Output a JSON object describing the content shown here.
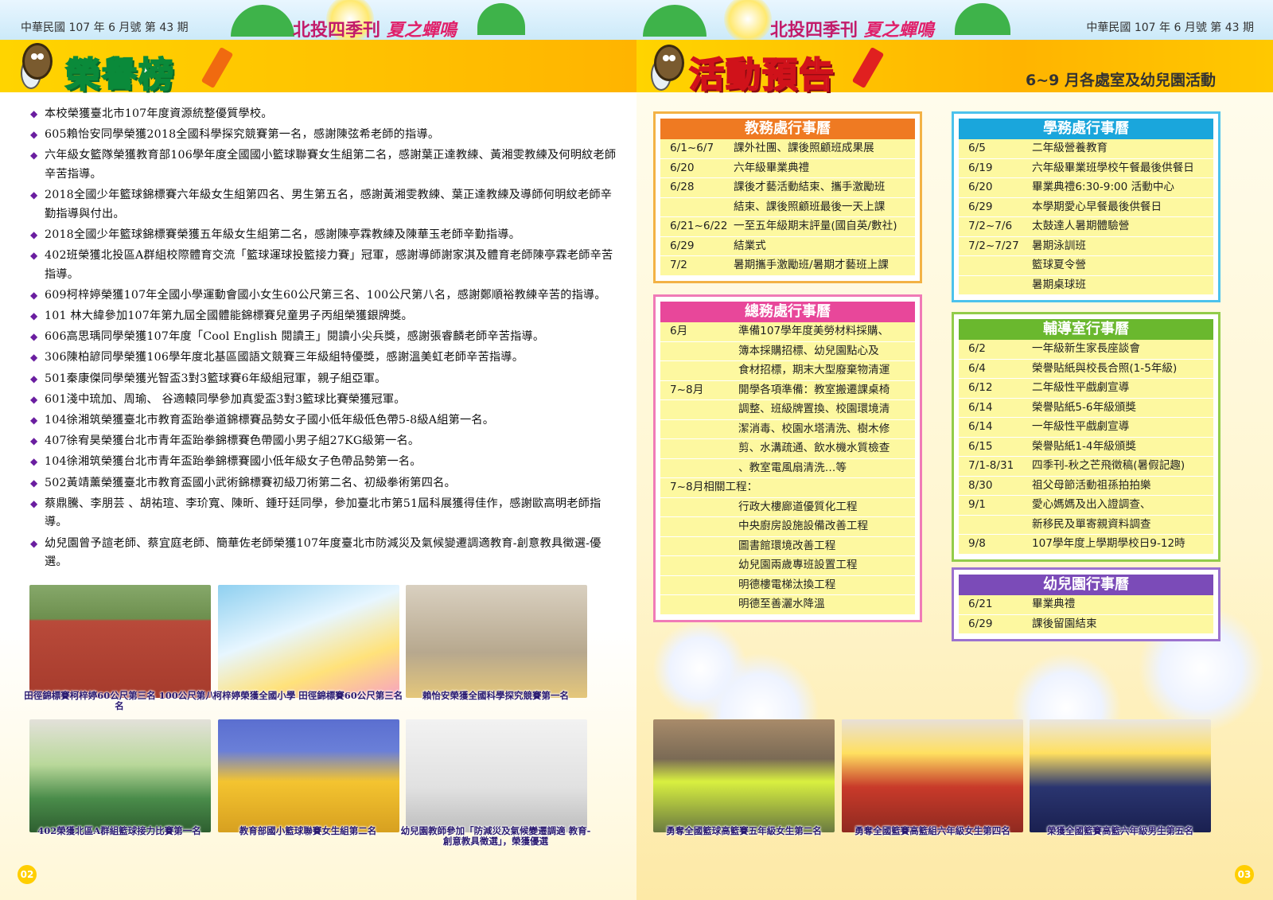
{
  "header": {
    "issue_left": "中華民國 107 年 6 月號 第 43 期",
    "issue_right": "中華民國 107 年 6 月號 第 43 期",
    "magazine": "北投四季刊",
    "magazine_sub": "夏之蟬鳴"
  },
  "left": {
    "section_title": "榮譽榜",
    "honors": [
      "本校榮獲臺北市107年度資源統整優質學校。",
      "605賴怡安同學榮獲2018全國科學探究競賽第一名，感謝陳弦希老師的指導。",
      "六年級女籃隊榮獲教育部106學年度全國國小籃球聯賽女生組第二名，感謝葉正達教練、黃湘雯教練及何明紋老師辛苦指導。",
      "2018全國少年籃球錦標賽六年級女生組第四名、男生第五名，感謝黃湘雯教練、葉正達教練及導師何明紋老師辛勤指導與付出。",
      "2018全國少年籃球錦標賽榮獲五年級女生組第二名，感謝陳亭霖教練及陳華玉老師辛勤指導。",
      "402班榮獲北投區A群組校際體育交流「籃球運球投籃接力賽」冠軍，感謝導師謝家淇及體育老師陳亭霖老師辛苦指導。",
      "609柯梓婷榮獲107年全國小學運動會國小女生60公尺第三名、100公尺第八名，感謝鄭順裕教練辛苦的指導。",
      "101 林大緯參加107年第九屆全國體能錦標賽兒童男子丙組榮獲銀牌獎。",
      "606高思瑀同學榮獲107年度「Cool English 閱讀王」閱讀小尖兵獎，感謝張睿麟老師辛苦指導。",
      "306陳柏諺同學榮獲106學年度北基區國語文競賽三年級組特優獎，感謝溫美虹老師辛苦指導。",
      "501秦康傑同學榮獲光智盃3對3籃球賽6年級組冠軍，親子組亞軍。",
      "601淺中琉加、周瑜、 谷適轅同學參加真愛盃3對3籃球比賽榮獲冠軍。",
      "104徐湘筑榮獲臺北市教育盃跆拳道錦標賽品勢女子國小低年級低色帶5-8級A組第一名。",
      "407徐宥昊榮獲台北市青年盃跆拳錦標賽色帶國小男子組27KG級第一名。",
      "104徐湘筑榮獲台北市青年盃跆拳錦標賽國小低年級女子色帶品勢第一名。",
      "502黃靖薰榮獲臺北市教育盃國小武術錦標賽初級刀術第二名、初級拳術第四名。",
      "蔡鼎騰、李朋芸 、胡祐瑄、李玠寬、陳昕、鍾玗廷同學，參加臺北市第51屆科展獲得佳作，感謝歐高明老師指導。",
      "幼兒園曾予諠老師、蔡宜庭老師、簡華佐老師榮獲107年度臺北市防減災及氣候變遷調適教育-創意教具徵選-優選。"
    ],
    "photos_row1": [
      {
        "caption": "田徑錦標賽柯梓婷60公尺第三名 100公尺第八名"
      },
      {
        "caption": "柯梓婷榮獲全國小學 田徑錦標賽60公尺第三名"
      },
      {
        "caption": "賴怡安榮獲全國科學探究競賽第一名"
      }
    ],
    "photos_row2": [
      {
        "caption": "402榮獲北區A群組籃球接力比賽第一名"
      },
      {
        "caption": "教育部國小籃球聯賽女生組第二名"
      },
      {
        "caption": "幼兒園教師參加「防減災及氣候變遷調適 教育-創意教具徵選」，榮獲優選"
      }
    ],
    "page_number": "02"
  },
  "right": {
    "section_title": "活動預告",
    "subtitle": "6~9 月各處室及幼兒園活動",
    "academic": {
      "title": "教務處行事曆",
      "color": "#ef7a22",
      "rows": [
        {
          "date": "6/1~6/7",
          "text": "課外社團、課後照顧班成果展"
        },
        {
          "date": "6/20",
          "text": "六年級畢業典禮"
        },
        {
          "date": "6/28",
          "text": "課後才藝活動結束、攜手激勵班"
        },
        {
          "date": "",
          "text": "結束、課後照顧班最後一天上課"
        },
        {
          "date": "6/21~6/22",
          "text": "一至五年級期末評量(國自英/數社)"
        },
        {
          "date": "6/29",
          "text": "結業式"
        },
        {
          "date": "7/2",
          "text": "暑期攜手激勵班/暑期才藝班上課"
        }
      ]
    },
    "general": {
      "title": "總務處行事曆",
      "color": "#e8479a",
      "rows": [
        {
          "date": "6月",
          "text": "準備107學年度美勞材料採購、"
        },
        {
          "date": "",
          "text": "簿本採購招標、幼兒園點心及"
        },
        {
          "date": "",
          "text": "食材招標，期末大型廢棄物清運"
        },
        {
          "date": "7~8月",
          "text": "開學各項準備：教室搬遷課桌椅"
        },
        {
          "date": "",
          "text": "調整、班級牌置換、校園環境清"
        },
        {
          "date": "",
          "text": "潔消毒、校園水塔清洗、樹木修"
        },
        {
          "date": "",
          "text": "剪、水溝疏通、飲水機水質檢查"
        },
        {
          "date": "",
          "text": "、教室電風扇清洗…等"
        },
        {
          "date": "7~8月相關工程：",
          "text": ""
        },
        {
          "date": "",
          "text": "行政大樓廊道優質化工程"
        },
        {
          "date": "",
          "text": "中央廚房設施設備改善工程"
        },
        {
          "date": "",
          "text": "圖書館環境改善工程"
        },
        {
          "date": "",
          "text": "幼兒園兩歲專班設置工程"
        },
        {
          "date": "",
          "text": "明德樓電梯汰換工程"
        },
        {
          "date": "",
          "text": "明德至善灑水降溫"
        }
      ]
    },
    "student": {
      "title": "學務處行事曆",
      "color": "#1aa6dc",
      "rows": [
        {
          "date": "6/5",
          "text": "二年級營養教育"
        },
        {
          "date": "6/19",
          "text": "六年級畢業班學校午餐最後供餐日"
        },
        {
          "date": "6/20",
          "text": "畢業典禮6:30-9:00 活動中心"
        },
        {
          "date": "6/29",
          "text": "本學期愛心早餐最後供餐日"
        },
        {
          "date": "7/2~7/6",
          "text": "太鼓達人暑期體驗營"
        },
        {
          "date": "7/2~7/27",
          "text": "暑期泳訓班"
        },
        {
          "date": "",
          "text": "籃球夏令營"
        },
        {
          "date": "",
          "text": "暑期桌球班"
        }
      ]
    },
    "counseling": {
      "title": "輔導室行事曆",
      "color": "#6ab82e",
      "rows": [
        {
          "date": "6/2",
          "text": "一年級新生家長座談會"
        },
        {
          "date": "6/4",
          "text": "榮譽貼紙與校長合照(1-5年級)"
        },
        {
          "date": "6/12",
          "text": "二年級性平戲劇宣導"
        },
        {
          "date": "6/14",
          "text": "榮譽貼紙5-6年級頒獎"
        },
        {
          "date": "6/14",
          "text": "一年級性平戲劇宣導"
        },
        {
          "date": "6/15",
          "text": "榮譽貼紙1-4年級頒獎"
        },
        {
          "date": "7/1-8/31",
          "text": "四季刊-秋之芒飛徵稿(暑假記趣)"
        },
        {
          "date": "8/30",
          "text": "祖父母節活動祖孫拍拍樂"
        },
        {
          "date": "9/1",
          "text": "愛心媽媽及出入證調查、"
        },
        {
          "date": "",
          "text": "新移民及單寄親資料調查"
        },
        {
          "date": "9/8",
          "text": "107學年度上學期學校日9-12時"
        }
      ]
    },
    "kindergarten": {
      "title": "幼兒園行事曆",
      "color": "#7b4bb8",
      "rows": [
        {
          "date": "6/21",
          "text": "畢業典禮"
        },
        {
          "date": "6/29",
          "text": "課後留園結束"
        }
      ]
    },
    "photos": [
      {
        "caption": "勇奪全國籃球高籃賽五年級女生第二名"
      },
      {
        "caption": "勇奪全國籃賽高籃組六年級女生第四名"
      },
      {
        "caption": "榮獲全國籃賽高籃六年級男生第五名"
      }
    ],
    "page_number": "03"
  }
}
